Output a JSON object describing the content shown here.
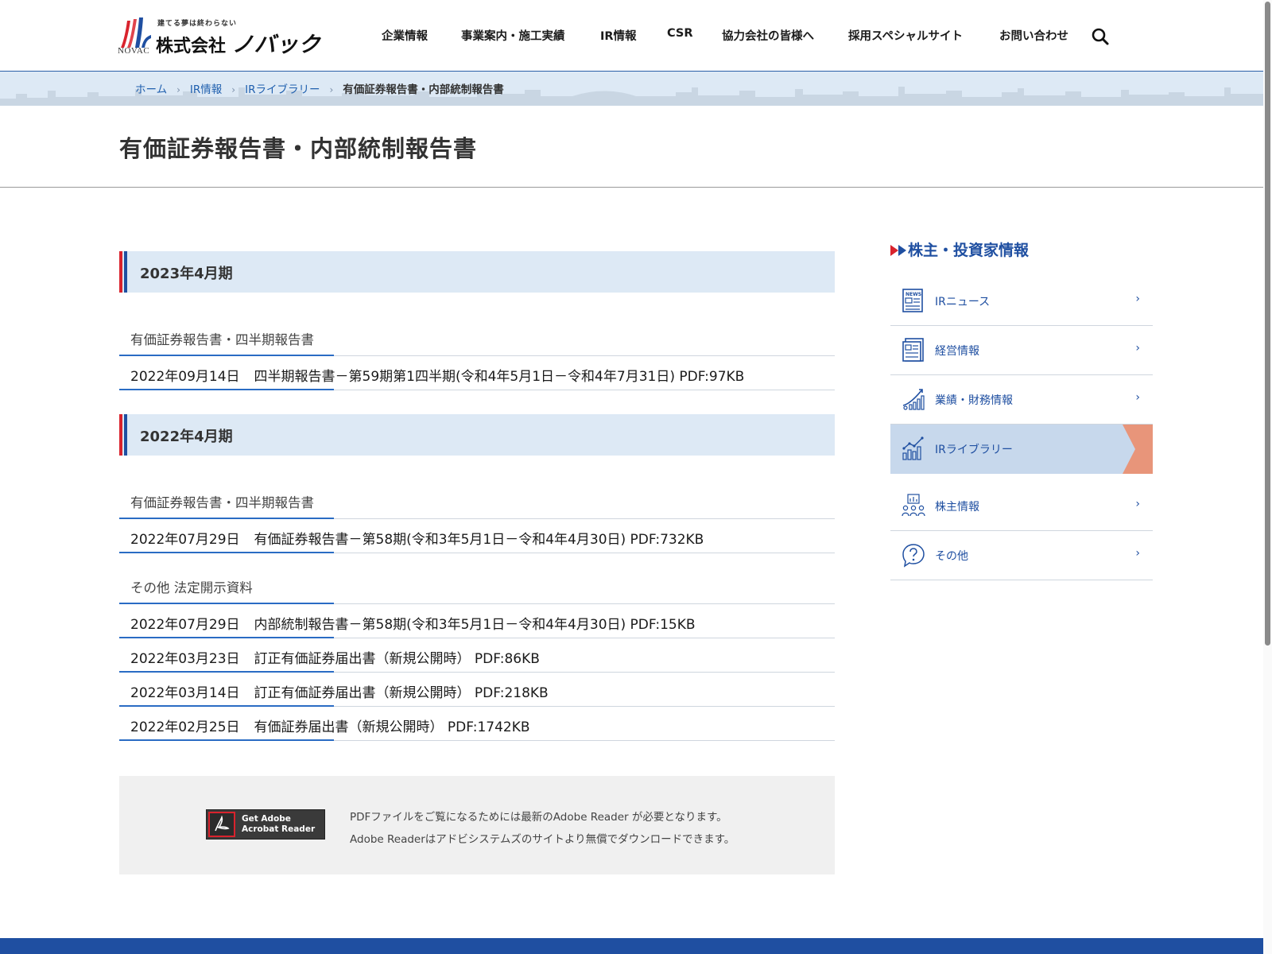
{
  "logo": {
    "tagline": "建てる夢は終わらない",
    "company_prefix": "株式会社",
    "brand": "ノバック",
    "sub": "NOVAC"
  },
  "nav": {
    "items": [
      "企業情報",
      "事業案内・施工実績",
      "IR情報",
      "CSR",
      "協力会社の皆様へ",
      "採用スペシャルサイト",
      "お問い合わせ"
    ]
  },
  "breadcrumb": {
    "home": "ホーム",
    "ir": "IR情報",
    "library": "IRライブラリー",
    "current": "有価証券報告書・内部統制報告書"
  },
  "page_title": "有価証券報告書・内部統制報告書",
  "sections": [
    {
      "year": "2023年4月期",
      "groups": [
        {
          "heading": "有価証券報告書・四半期報告書",
          "docs": [
            {
              "date": "2022年09月14日",
              "title": "四半期報告書－第59期第1四半期(令和4年5月1日－令和4年7月31日) PDF:97KB"
            }
          ]
        }
      ]
    },
    {
      "year": "2022年4月期",
      "groups": [
        {
          "heading": "有価証券報告書・四半期報告書",
          "docs": [
            {
              "date": "2022年07月29日",
              "title": "有価証券報告書－第58期(令和3年5月1日－令和4年4月30日) PDF:732KB"
            }
          ]
        },
        {
          "heading": "その他 法定開示資料",
          "docs": [
            {
              "date": "2022年07月29日",
              "title": "内部統制報告書－第58期(令和3年5月1日－令和4年4月30日) PDF:15KB"
            },
            {
              "date": "2022年03月23日",
              "title": "訂正有価証券届出書（新規公開時） PDF:86KB"
            },
            {
              "date": "2022年03月14日",
              "title": "訂正有価証券届出書（新規公開時） PDF:218KB"
            },
            {
              "date": "2022年02月25日",
              "title": "有価証券届出書（新規公開時） PDF:1742KB"
            }
          ]
        }
      ]
    }
  ],
  "reader": {
    "badge_line1": "Get Adobe",
    "badge_line2": "Acrobat Reader",
    "note_line1": "PDFファイルをご覧になるためには最新のAdobe Reader が必要となります。",
    "note_line2": "Adobe Readerはアドビシステムズのサイトより無償でダウンロードできます。"
  },
  "sidebar": {
    "title": "株主・投資家情報",
    "items": [
      {
        "label": "IRニュース",
        "icon": "news-icon"
      },
      {
        "label": "経営情報",
        "icon": "document-icon"
      },
      {
        "label": "業績・財務情報",
        "icon": "growth-chart-icon"
      },
      {
        "label": "IRライブラリー",
        "icon": "bar-chart-icon",
        "active": true
      },
      {
        "label": "株主情報",
        "icon": "shareholders-icon"
      },
      {
        "label": "その他",
        "icon": "question-icon"
      }
    ]
  },
  "colors": {
    "brand_blue": "#1f4fa1",
    "accent_red": "#d9232d",
    "band_blue": "#dde9f5",
    "active_orange": "#e8957a"
  }
}
